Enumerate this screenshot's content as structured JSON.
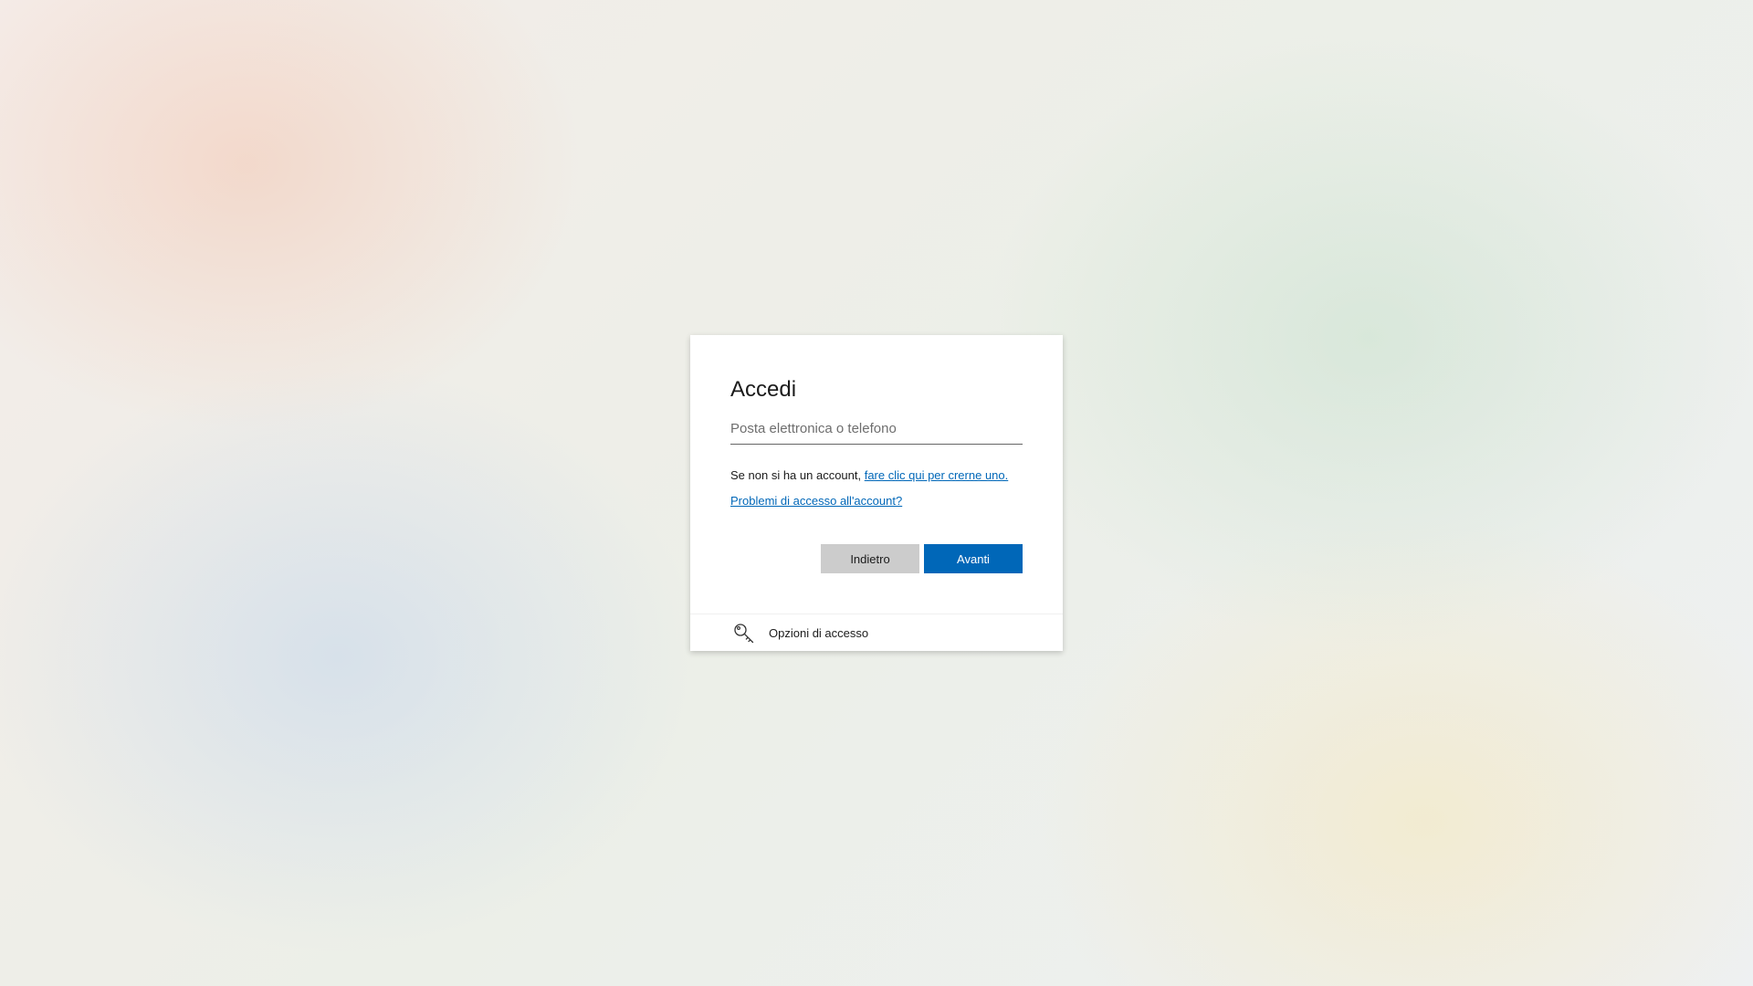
{
  "signin": {
    "title": "Accedi",
    "email_placeholder": "Posta elettronica o telefono",
    "email_value": "",
    "no_account_text": "Se non si ha un account, ",
    "create_account_link": "fare clic qui per crerne uno.",
    "access_problems_link": "Problemi di accesso all'account?",
    "back_button": "Indietro",
    "next_button": "Avanti",
    "accent_color": "#0067b8"
  },
  "footer": {
    "icon": "key-icon",
    "label": "Opzioni di accesso"
  }
}
